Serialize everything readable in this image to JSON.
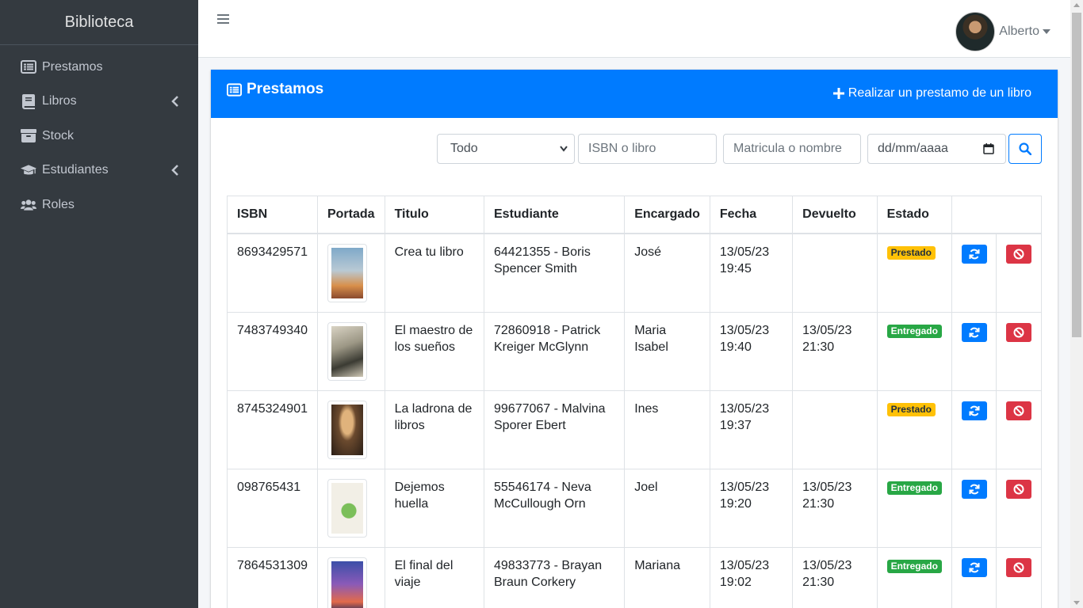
{
  "app": {
    "brand": "Biblioteca"
  },
  "sidebar": {
    "items": [
      {
        "label": "Prestamos",
        "icon": "list-alt-icon"
      },
      {
        "label": "Libros",
        "icon": "book-icon",
        "has_children": true
      },
      {
        "label": "Stock",
        "icon": "archive-icon"
      },
      {
        "label": "Estudiantes",
        "icon": "graduation-cap-icon",
        "has_children": true
      },
      {
        "label": "Roles",
        "icon": "users-icon"
      }
    ]
  },
  "topbar": {
    "user_name": "Alberto"
  },
  "card": {
    "title": "Prestamos",
    "action_label": "Realizar un prestamo de un libro",
    "header_color": "#007bff"
  },
  "filters": {
    "status_selected": "Todo",
    "isbn_placeholder": "ISBN o libro",
    "student_placeholder": "Matricula o nombre",
    "date_placeholder": "dd/mm/aaaa"
  },
  "table": {
    "headers": [
      "ISBN",
      "Portada",
      "Titulo",
      "Estudiante",
      "Encargado",
      "Fecha",
      "Devuelto",
      "Estado",
      ""
    ],
    "rows": [
      {
        "isbn": "8693429571",
        "title": "Crea tu libro",
        "student": "64421355 - Boris Spencer Smith",
        "staff": "José",
        "date": "13/05/23 19:45",
        "returned": "",
        "status": "Prestado",
        "status_type": "warning"
      },
      {
        "isbn": "7483749340",
        "title": "El maestro de los sueños",
        "student": "72860918 - Patrick Kreiger McGlynn",
        "staff": "Maria Isabel",
        "date": "13/05/23 19:40",
        "returned": "13/05/23 21:30",
        "status": "Entregado",
        "status_type": "success"
      },
      {
        "isbn": "8745324901",
        "title": "La ladrona de libros",
        "student": "99677067 - Malvina Sporer Ebert",
        "staff": "Ines",
        "date": "13/05/23 19:37",
        "returned": "",
        "status": "Prestado",
        "status_type": "warning"
      },
      {
        "isbn": "098765431",
        "title": "Dejemos huella",
        "student": "55546174 - Neva McCullough Orn",
        "staff": "Joel",
        "date": "13/05/23 19:20",
        "returned": "13/05/23 21:30",
        "status": "Entregado",
        "status_type": "success"
      },
      {
        "isbn": "7864531309",
        "title": "El final del viaje",
        "student": "49833773 - Brayan Braun Corkery",
        "staff": "Mariana",
        "date": "13/05/23 19:02",
        "returned": "13/05/23 21:30",
        "status": "Entregado",
        "status_type": "success"
      }
    ]
  },
  "colors": {
    "sidebar_bg": "#343a40",
    "primary": "#007bff",
    "danger": "#dc3545",
    "warning": "#ffc107",
    "success": "#28a745"
  }
}
